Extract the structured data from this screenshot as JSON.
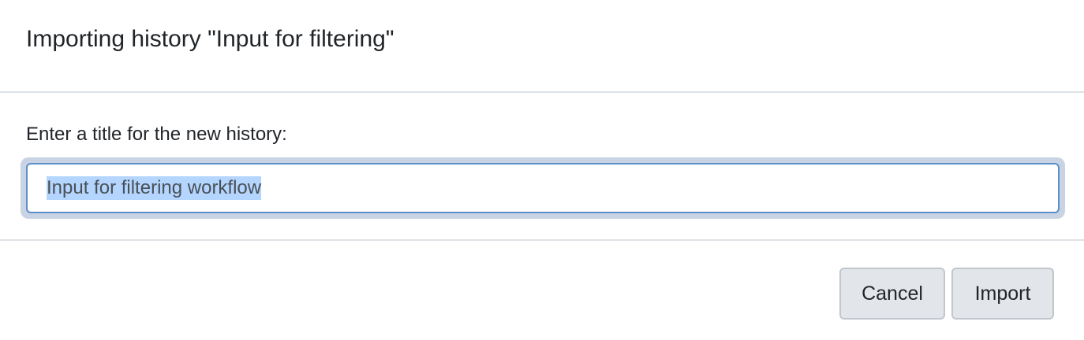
{
  "dialog": {
    "title": "Importing history \"Input for filtering\""
  },
  "form": {
    "label": "Enter a title for the new history:",
    "title_input": {
      "value": "Input for filtering workflow",
      "selected": true
    }
  },
  "footer": {
    "cancel_label": "Cancel",
    "import_label": "Import"
  },
  "colors": {
    "border": "#dee2e6",
    "input_focus_border": "#5b8fc7",
    "focus_ring": "#c8d4e4",
    "selection_highlight": "#b4d5fe",
    "button_bg": "#e2e6ea"
  }
}
